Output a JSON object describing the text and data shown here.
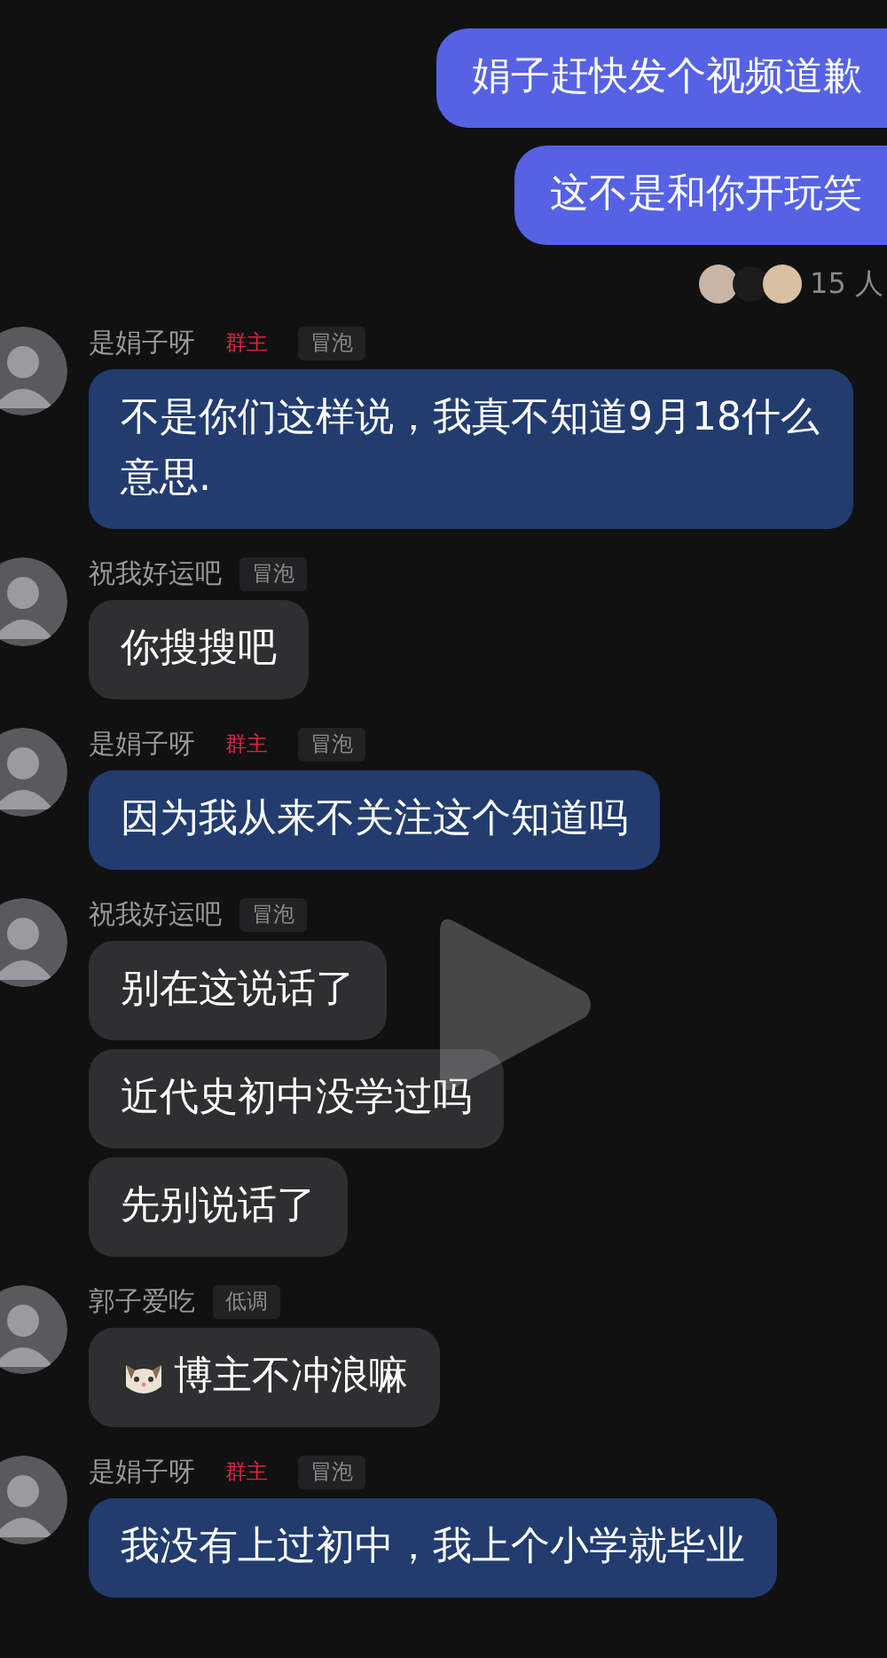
{
  "outgoing": [
    {
      "text": "娟子赶快发个视频道歉"
    },
    {
      "text": "这不是和你开玩笑"
    }
  ],
  "read_receipt": {
    "count": "15 人"
  },
  "groups": [
    {
      "sender": "是娟子呀",
      "badges": [
        {
          "kind": "owner",
          "label": "群主"
        },
        {
          "kind": "level",
          "label": "冒泡"
        }
      ],
      "messages": [
        {
          "text": "不是你们这样说，我真不知道9月18什么意思.",
          "owner": true,
          "emoji": false
        }
      ]
    },
    {
      "sender": "祝我好运吧",
      "badges": [
        {
          "kind": "level",
          "label": "冒泡"
        }
      ],
      "messages": [
        {
          "text": "你搜搜吧",
          "owner": false,
          "emoji": false
        }
      ]
    },
    {
      "sender": "是娟子呀",
      "badges": [
        {
          "kind": "owner",
          "label": "群主"
        },
        {
          "kind": "level",
          "label": "冒泡"
        }
      ],
      "messages": [
        {
          "text": "因为我从来不关注这个知道吗",
          "owner": true,
          "emoji": false
        }
      ]
    },
    {
      "sender": "祝我好运吧",
      "badges": [
        {
          "kind": "level",
          "label": "冒泡"
        }
      ],
      "messages": [
        {
          "text": "别在这说话了",
          "owner": false,
          "emoji": false
        },
        {
          "text": "近代史初中没学过吗",
          "owner": false,
          "emoji": false
        },
        {
          "text": "先别说话了",
          "owner": false,
          "emoji": false
        }
      ]
    },
    {
      "sender": "郭子爱吃",
      "badges": [
        {
          "kind": "level",
          "label": "低调"
        }
      ],
      "messages": [
        {
          "text": "博主不冲浪嘛",
          "owner": false,
          "emoji": true
        }
      ]
    },
    {
      "sender": "是娟子呀",
      "badges": [
        {
          "kind": "owner",
          "label": "群主"
        },
        {
          "kind": "level",
          "label": "冒泡"
        }
      ],
      "messages": [
        {
          "text": "我没有上过初中，我上个小学就毕业",
          "owner": true,
          "emoji": false
        }
      ]
    }
  ]
}
